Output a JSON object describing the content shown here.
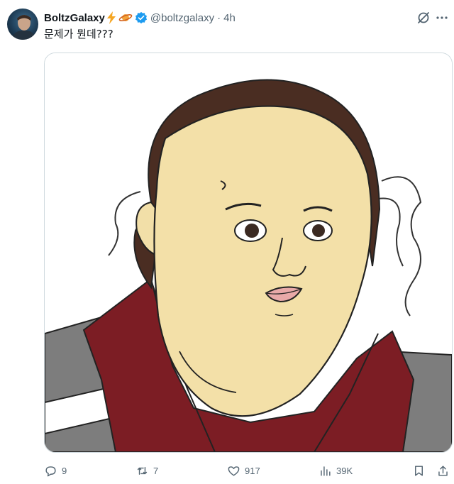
{
  "tweet": {
    "author": {
      "name": "BoltzGalaxy",
      "handle": "@boltzgalaxy",
      "emojis": [
        "lightning-emoji",
        "ringed-planet-emoji"
      ],
      "verified": true
    },
    "timestamp": "4h",
    "separator": "·",
    "text": "문제가 뭔데???",
    "media": {
      "type": "image",
      "alt": "cartoon drawing of a man"
    }
  },
  "actions": {
    "reply_count": "9",
    "repost_count": "7",
    "like_count": "917",
    "view_count": "39K"
  },
  "colors": {
    "accent": "#1d9bf0",
    "text_primary": "#0f1419",
    "text_secondary": "#536471",
    "border": "#cfd9de"
  }
}
